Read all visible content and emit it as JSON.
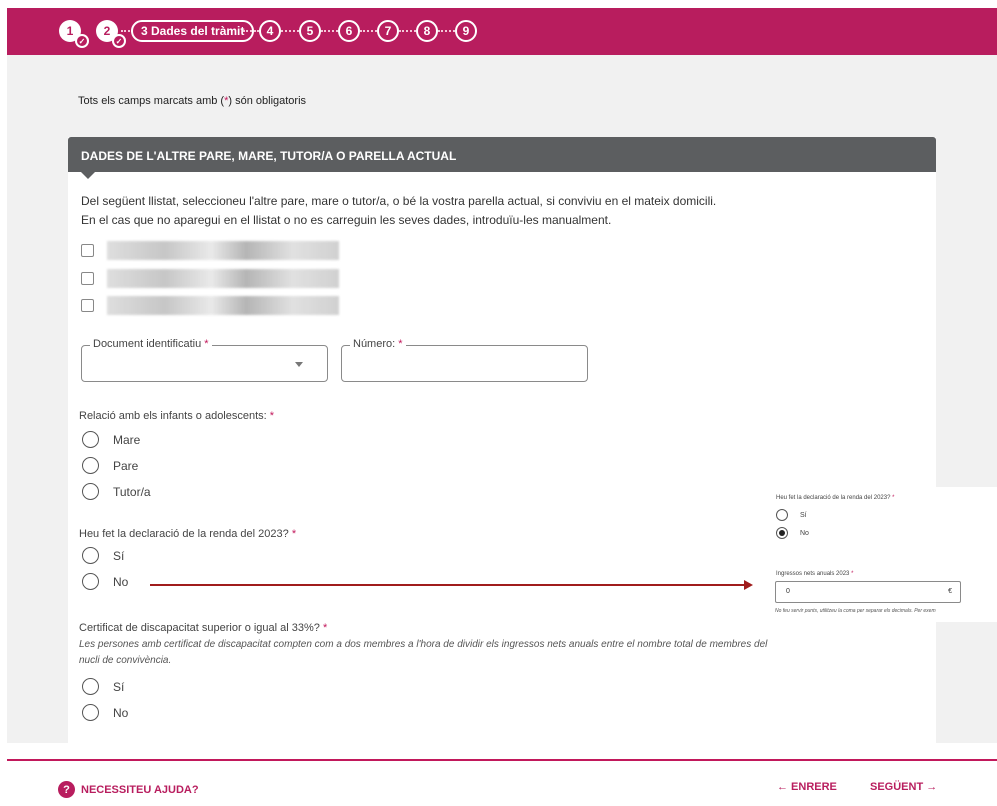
{
  "stepper": {
    "steps": [
      {
        "label": "1",
        "state": "done"
      },
      {
        "label": "2",
        "state": "done"
      },
      {
        "label": "3 Dades del tràmit",
        "state": "active"
      },
      {
        "label": "4",
        "state": "pending"
      },
      {
        "label": "5",
        "state": "pending"
      },
      {
        "label": "6",
        "state": "pending"
      },
      {
        "label": "7",
        "state": "pending"
      },
      {
        "label": "8",
        "state": "pending"
      },
      {
        "label": "9",
        "state": "pending"
      }
    ]
  },
  "required_note": {
    "before": "Tots els camps marcats amb (",
    "star": "*",
    "after": ") són obligatoris"
  },
  "section": {
    "title": "DADES DE L'ALTRE PARE, MARE, TUTOR/A O PARELLA ACTUAL",
    "intro_line1": "Del següent llistat, seleccioneu l'altre pare, mare o tutor/a, o bé la vostra parella actual, si conviviu en el mateix domicili.",
    "intro_line2": "En el cas que no aparegui en el llistat o no es carreguin les seves dades, introduïu-les manualment."
  },
  "document_field": {
    "label": "Document identificatiu",
    "star": "*",
    "value": ""
  },
  "number_field": {
    "label": "Número:",
    "star": "*",
    "value": ""
  },
  "relation": {
    "label": "Relació amb els infants o adolescents:",
    "star": "*",
    "options": [
      "Mare",
      "Pare",
      "Tutor/a"
    ]
  },
  "income_declaration": {
    "label": "Heu fet la declaració de la renda del 2023?",
    "star": "*",
    "options": [
      "Sí",
      "No"
    ]
  },
  "disability": {
    "label": "Certificat de discapacitat superior o igual al 33%?",
    "star": "*",
    "helper_line1": "Les persones amb certificat de discapacitat compten com a dos membres a l'hora de dividir els ingressos nets anuals entre el nombre total de membres del",
    "helper_line2": "nucli de convivència.",
    "options": [
      "Sí",
      "No"
    ]
  },
  "inset": {
    "question": "Heu fet la declaració de la renda del 2023?",
    "star": "*",
    "options": [
      "Sí",
      "No"
    ],
    "selected": "No",
    "income_label": "Ingressos nets anuals 2023",
    "income_value": "0",
    "currency": "€",
    "note": "No feu servir punts, utilitzeu la coma per separar els decimals. Per exem"
  },
  "footer": {
    "help": "NECESSITEU AJUDA?",
    "help_icon": "?",
    "back": "← ENRERE",
    "next": "SEGÜENT →"
  },
  "colors": {
    "brand": "#b81d5e",
    "header": "#5c5e60",
    "arrow": "#a01c1c"
  }
}
